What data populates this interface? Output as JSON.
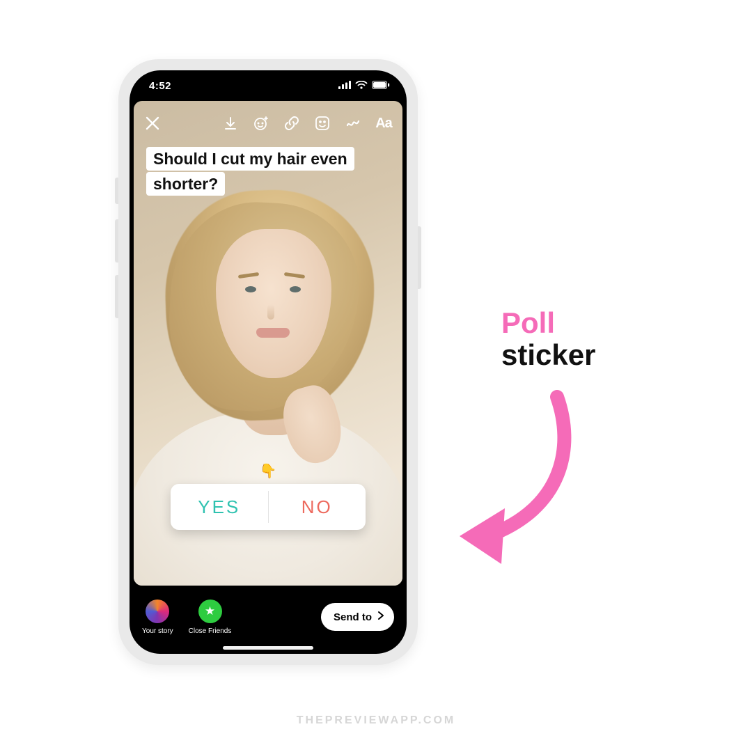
{
  "status": {
    "time": "4:52"
  },
  "story": {
    "caption": "Should I cut my hair even shorter?",
    "poll": {
      "option_a": "YES",
      "option_b": "NO"
    },
    "toolbar_text_icon": "Aa"
  },
  "bottom": {
    "your_story": "Your story",
    "close_friends": "Close Friends",
    "send_to": "Send to"
  },
  "callout": {
    "line1": "Poll",
    "line2": "sticker"
  },
  "watermark": "THEPREVIEWAPP.COM",
  "icons": {
    "close": "close-icon",
    "download": "download-icon",
    "effects": "sparkle-face-icon",
    "link": "link-icon",
    "sticker": "sticker-icon",
    "draw": "squiggle-icon",
    "text": "text-icon",
    "chevron": "chevron-right-icon",
    "star": "star-icon",
    "signal": "signal-icon",
    "wifi": "wifi-icon",
    "battery": "battery-icon"
  },
  "colors": {
    "pink": "#f56bb8",
    "poll_yes": "#2fc2b0",
    "poll_no": "#ed6a5e",
    "close_friends_green": "#2ecc40"
  }
}
